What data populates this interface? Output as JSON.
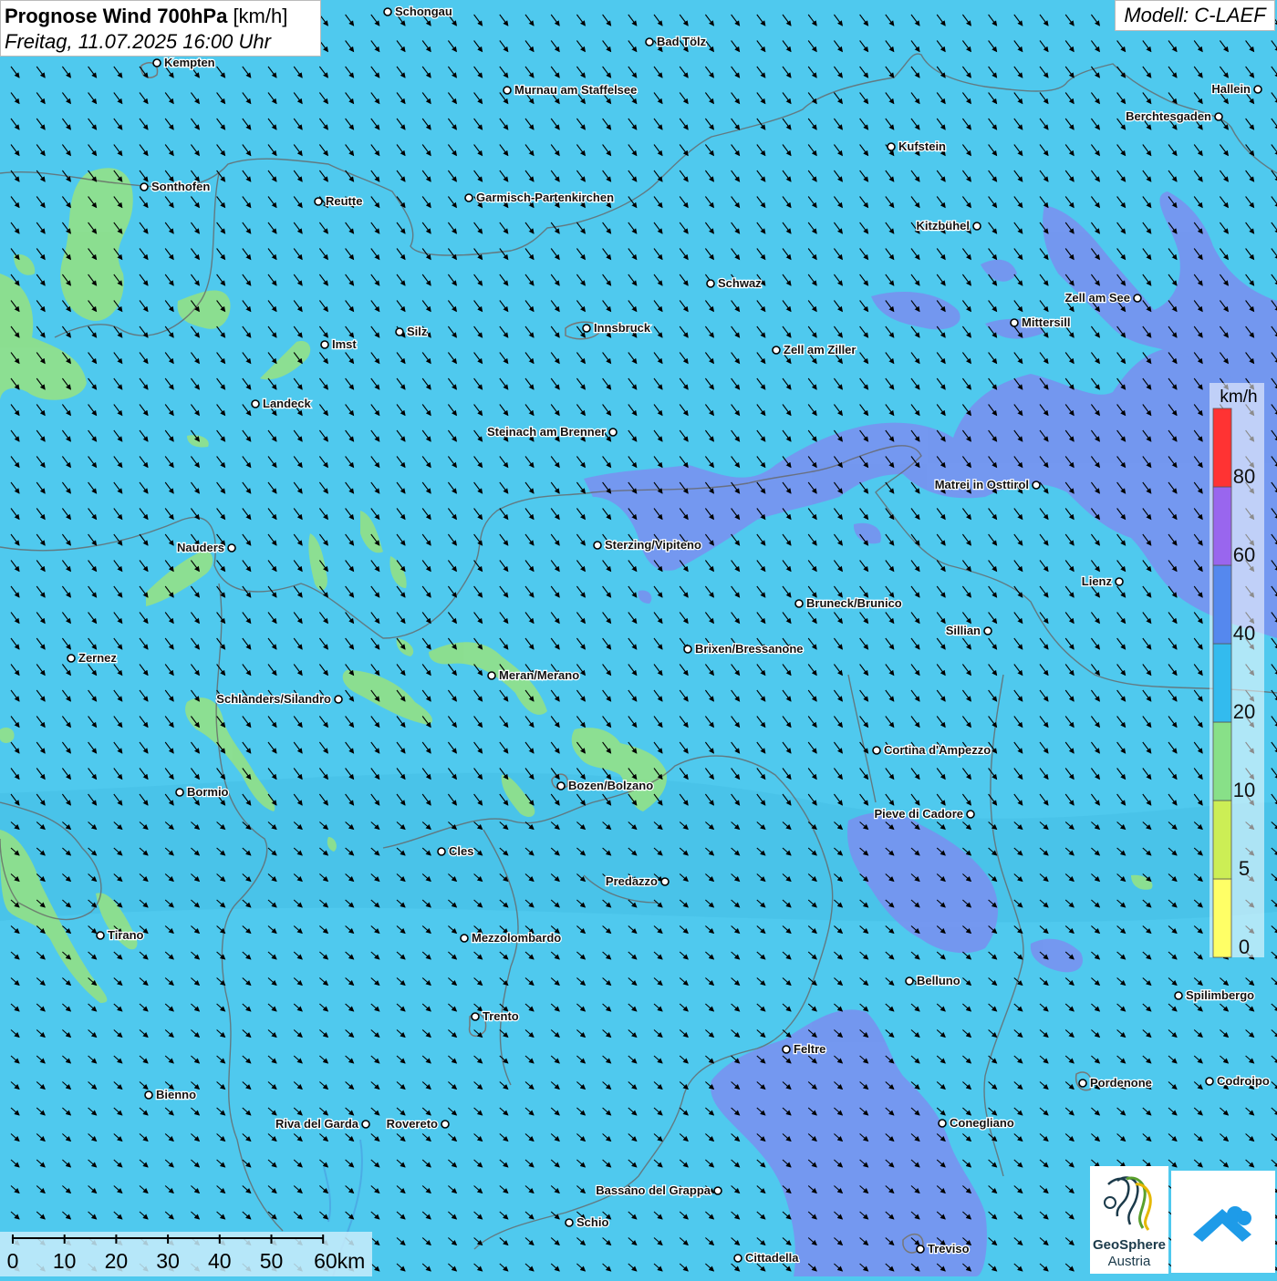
{
  "header": {
    "title_bold": "Prognose Wind 700hPa",
    "title_unit": "[km/h]",
    "datetime": "Freitag, 11.07.2025 16:00 Uhr",
    "model": "Modell: C-LAEF"
  },
  "legend": {
    "unit": "km/h",
    "stops": [
      {
        "label": "0",
        "color": "#ffff66"
      },
      {
        "label": "5",
        "color": "#ccee55"
      },
      {
        "label": "10",
        "color": "#88e088"
      },
      {
        "label": "20",
        "color": "#33bbee"
      },
      {
        "label": "40",
        "color": "#5588ee"
      },
      {
        "label": "60",
        "color": "#9966ee"
      },
      {
        "label": "80",
        "color": "#ff3333"
      }
    ]
  },
  "scalebar": {
    "ticks": [
      "0",
      "10",
      "20",
      "30",
      "40",
      "50",
      "60km"
    ]
  },
  "logos": {
    "geosphere_line1": "GeoSphere",
    "geosphere_line2": "Austria"
  },
  "cities": [
    {
      "name": "Schongau",
      "lx": "right"
    },
    {
      "name": "Bad Tölz",
      "lx": "right"
    },
    {
      "name": "Kempten",
      "lx": "right"
    },
    {
      "name": "Murnau am Staffelsee",
      "lx": "right"
    },
    {
      "name": "Hallein",
      "lx": "left"
    },
    {
      "name": "Berchtesgaden",
      "lx": "left"
    },
    {
      "name": "Kufstein",
      "lx": "right"
    },
    {
      "name": "Sonthofen",
      "lx": "right"
    },
    {
      "name": "Reutte",
      "lx": "right"
    },
    {
      "name": "Garmisch-Partenkirchen",
      "lx": "right"
    },
    {
      "name": "Kitzbühel",
      "lx": "left"
    },
    {
      "name": "Schwaz",
      "lx": "right"
    },
    {
      "name": "Zell am See",
      "lx": "left"
    },
    {
      "name": "Mittersill",
      "lx": "right"
    },
    {
      "name": "Innsbruck",
      "lx": "right"
    },
    {
      "name": "Silz",
      "lx": "right"
    },
    {
      "name": "Imst",
      "lx": "right"
    },
    {
      "name": "Zell am Ziller",
      "lx": "right"
    },
    {
      "name": "Landeck",
      "lx": "right"
    },
    {
      "name": "Steinach am Brenner",
      "lx": "left"
    },
    {
      "name": "Matrei in Osttirol",
      "lx": "left"
    },
    {
      "name": "Nauders",
      "lx": "left"
    },
    {
      "name": "Sterzing/Vipiteno",
      "lx": "right"
    },
    {
      "name": "Lienz",
      "lx": "left"
    },
    {
      "name": "Bruneck/Brunico",
      "lx": "right"
    },
    {
      "name": "Sillian",
      "lx": "left"
    },
    {
      "name": "Brixen/Bressanone",
      "lx": "right"
    },
    {
      "name": "Zernez",
      "lx": "right"
    },
    {
      "name": "Meran/Merano",
      "lx": "right"
    },
    {
      "name": "Schlanders/Silandro",
      "lx": "left"
    },
    {
      "name": "Cortina d'Ampezzo",
      "lx": "right"
    },
    {
      "name": "Bozen/Bolzano",
      "lx": "right"
    },
    {
      "name": "Bormio",
      "lx": "right"
    },
    {
      "name": "Pieve di Cadore",
      "lx": "left"
    },
    {
      "name": "Cles",
      "lx": "right"
    },
    {
      "name": "Predazzo",
      "lx": "left"
    },
    {
      "name": "Tirano",
      "lx": "right"
    },
    {
      "name": "Mezzolombardo",
      "lx": "right"
    },
    {
      "name": "Belluno",
      "lx": "right"
    },
    {
      "name": "Spilimbergo",
      "lx": "right"
    },
    {
      "name": "Trento",
      "lx": "right"
    },
    {
      "name": "Feltre",
      "lx": "right"
    },
    {
      "name": "Pordenone",
      "lx": "right"
    },
    {
      "name": "Codroipo",
      "lx": "right"
    },
    {
      "name": "Bienno",
      "lx": "right"
    },
    {
      "name": "Riva del Garda",
      "lx": "left"
    },
    {
      "name": "Rovereto",
      "lx": "left"
    },
    {
      "name": "Conegliano",
      "lx": "right"
    },
    {
      "name": "Bassano del Grappa",
      "lx": "left"
    },
    {
      "name": "Schio",
      "lx": "right"
    },
    {
      "name": "Treviso",
      "lx": "right"
    },
    {
      "name": "Cittadella",
      "lx": "right"
    }
  ]
}
